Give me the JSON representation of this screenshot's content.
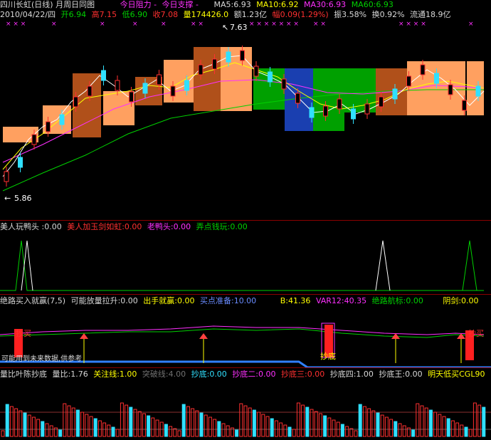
{
  "header": {
    "title": "四川长虹(日线) 月周日同图",
    "zhuli": "今日阻力 -",
    "zhicheng": "今日支撑 -",
    "ma5": "MA5:6.93",
    "ma10": "MA10:6.92",
    "ma30": "MA30:6.93",
    "ma60": "MA60:6.93",
    "date": "2010/04/22/四",
    "open": "开6.94",
    "high": "高7.15",
    "low": "低6.90",
    "close": "收7.08",
    "volume": "量174426.0",
    "amount": "额1.23亿",
    "change": "幅0.09(1.29%)",
    "amplitude": "振3.58%",
    "turnover": "换0.92%",
    "float": "流通18.9亿"
  },
  "main_chart": {
    "high_label": "7.63",
    "low_label": "5.86"
  },
  "panel1": {
    "name": "美人玩鸭头 :0.00",
    "l1": "美人加玉剑如虹:0.00",
    "l2": "老鸭头:0.00",
    "l3": "弄点钱玩:0.00"
  },
  "panel2": {
    "name": "绝路买入就赢(7,5)",
    "l1": "可能放量拉升:0.00",
    "l2": "出手就赢:0.00",
    "l3": "买点准备:10.00",
    "l4": "B:41.36",
    "l5": "VAR12:40.35",
    "l6": "绝路航标:0.00",
    "l7": "阴剑:0.00",
    "tag_buy_left": "抄买",
    "tag_buy_right": "抄买",
    "tag_bottom": "抄底",
    "hint": "可能用到未来数据,供参考"
  },
  "panel3": {
    "name": "量比叶陈抄底",
    "l1": "量比:1.76",
    "l2": "关注线:1.00",
    "l3": "突破线:4.00",
    "l4": "抄底:0.00",
    "l5": "抄底二:0.00",
    "l6": "抄底三:0.00",
    "l7": "抄底四:1.00",
    "l8": "抄底王:0.00",
    "l9": "明天低买CGL90"
  },
  "colors": {
    "up": "#ff3030",
    "down": "#30e0ff",
    "ma5": "#ffffff",
    "ma10": "#ffff00",
    "ma30": "#ff30ff",
    "ma60": "#00d000"
  }
}
